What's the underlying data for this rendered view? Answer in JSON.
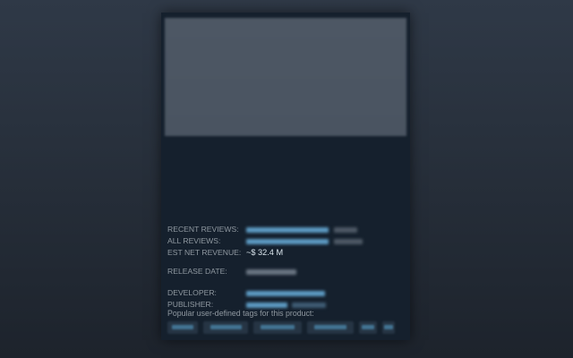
{
  "store_card": {
    "description": "",
    "labels": {
      "recent_reviews": "RECENT REVIEWS:",
      "all_reviews": "ALL REVIEWS:",
      "est_net_revenue": "EST NET REVENUE:",
      "release_date": "RELEASE DATE:",
      "developer": "DEVELOPER:",
      "publisher": "PUBLISHER:"
    },
    "values": {
      "est_net_revenue": "~$ 32.4 M"
    },
    "tags_heading": "Popular user-defined tags for this product:"
  },
  "colors": {
    "page_background": "#2a323d",
    "panel_background": "#15202d",
    "header_image": "#4b5562",
    "label_text": "#8f98a0",
    "link_text": "#67c1f5",
    "tag_background": "#263544"
  }
}
